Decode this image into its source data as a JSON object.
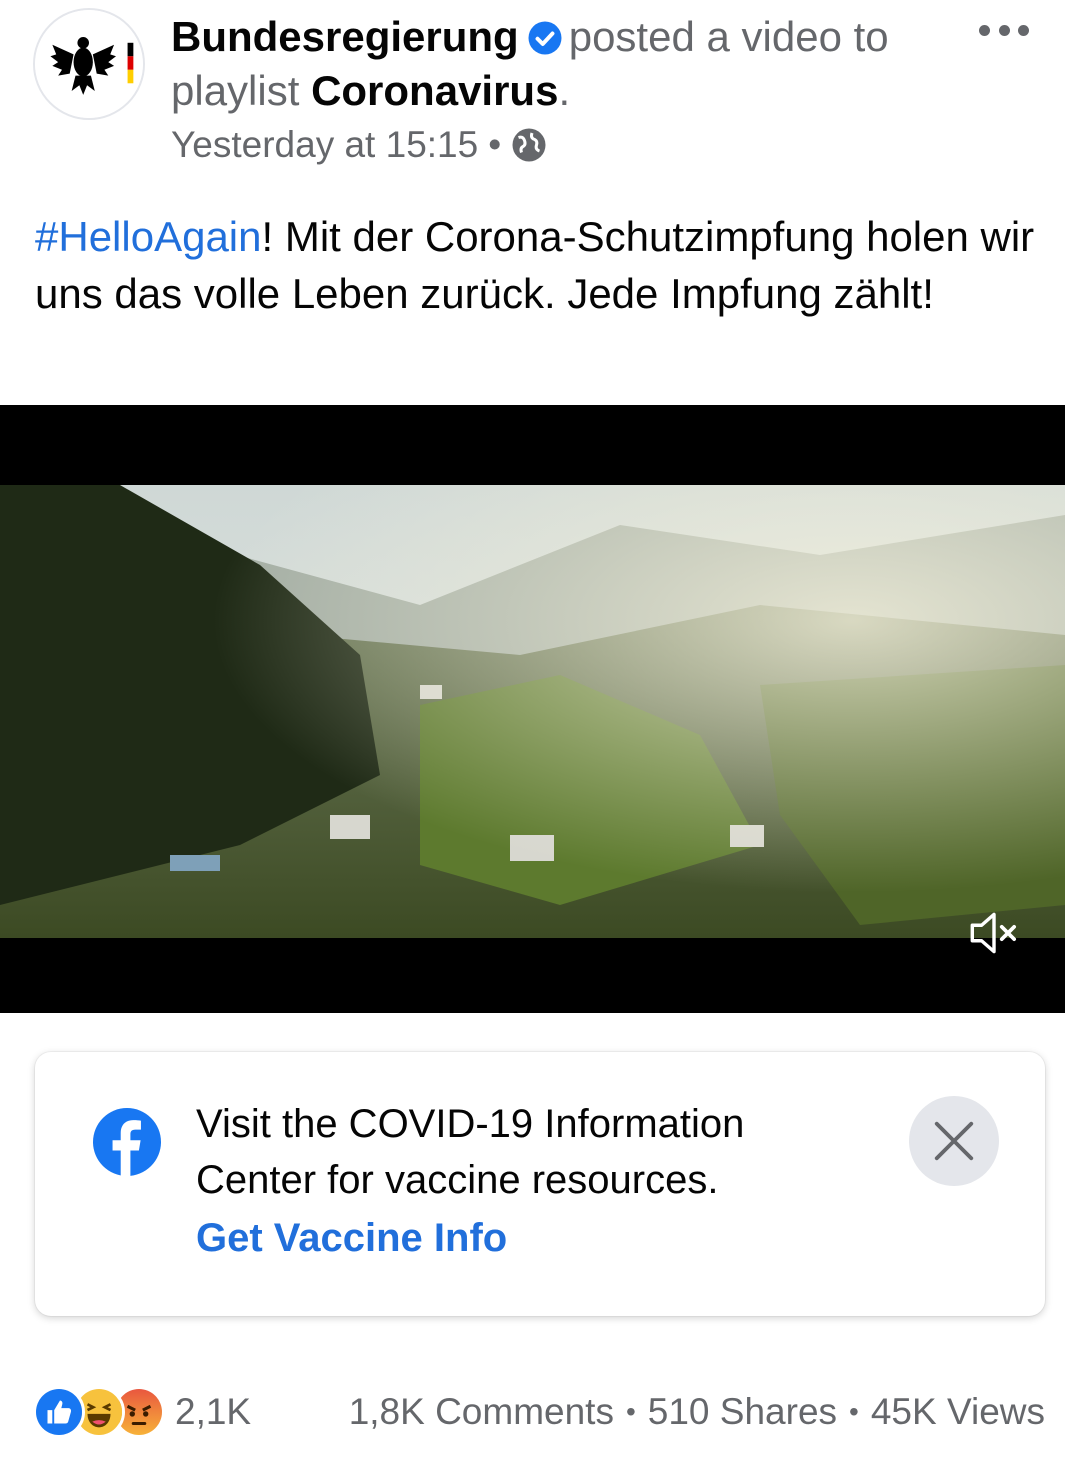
{
  "post": {
    "page_name": "Bundesregierung",
    "action_text": "posted a video to playlist",
    "playlist_name": "Coronavirus",
    "end_punct": ".",
    "timestamp": "Yesterday at 15:15",
    "separator": "•",
    "hashtag": "#HelloAgain",
    "body_text": "! Mit der Corona-Schutzimpfung holen wir uns das volle Leben zurück. Jede Impfung zählt!",
    "icons": {
      "privacy": "globe-icon",
      "verified": "verified-badge-icon",
      "more": "more-options-icon"
    }
  },
  "video": {
    "mute_icon": "speaker-muted-icon"
  },
  "info_card": {
    "text": "Visit the COVID-19 Information Center for vaccine resources.",
    "link_label": "Get Vaccine Info",
    "icons": {
      "logo": "facebook-icon",
      "close": "close-icon"
    },
    "colors": {
      "link": "#216fdb"
    }
  },
  "footer": {
    "reaction_icons": [
      "like-icon",
      "haha-icon",
      "angry-icon"
    ],
    "reaction_count": "2,1K",
    "comments": "1,8K Comments",
    "shares": "510 Shares",
    "views": "45K Views",
    "separator": "•"
  }
}
